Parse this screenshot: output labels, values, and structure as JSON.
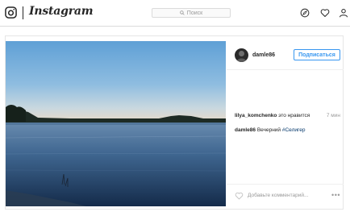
{
  "header": {
    "brand": "Instagram",
    "search_placeholder": "Поиск",
    "icons": [
      "instagram-logo-icon",
      "search-icon",
      "explore-compass-icon",
      "heart-icon",
      "profile-icon"
    ]
  },
  "post": {
    "author": "damle86",
    "follow_label": "Подписаться",
    "likes": {
      "user": "lilya_komchenko",
      "text": "это нравится",
      "time": "7 мин"
    },
    "caption": {
      "user": "damle86",
      "text": "Вечерний",
      "hashtag": "#Селигер"
    },
    "comment_placeholder": "Добавьте комментарий...",
    "more_label": "•••",
    "image_description_icon": "lake-landscape-photo"
  },
  "colors": {
    "accent": "#3897f0",
    "border": "#dbdbdb",
    "text": "#262626",
    "muted": "#999999",
    "hashtag": "#003569"
  }
}
